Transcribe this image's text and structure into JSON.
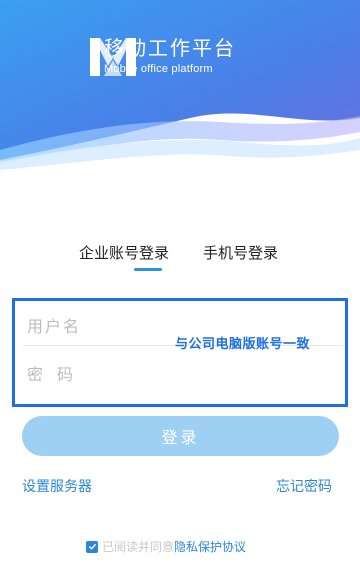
{
  "brand": {
    "title": "移动工作平台",
    "subtitle": "Mobile office platform",
    "icon": "m-logo-icon"
  },
  "tabs": [
    {
      "label": "企业账号登录",
      "selected": true
    },
    {
      "label": "手机号登录",
      "selected": false
    }
  ],
  "form": {
    "username_placeholder": "用户名",
    "password_placeholder": "密码",
    "annotation": "与公司电脑版账号一致"
  },
  "login_button": "登录",
  "links": {
    "server_settings": "设置服务器",
    "forgot_password": "忘记密码"
  },
  "agreement": {
    "checked": true,
    "text": "已阅读并同意",
    "link": "隐私保护协议"
  },
  "colors": {
    "accent": "#2a86d8",
    "button": "#9ed0f4",
    "annotation": "#1f6fe0"
  }
}
